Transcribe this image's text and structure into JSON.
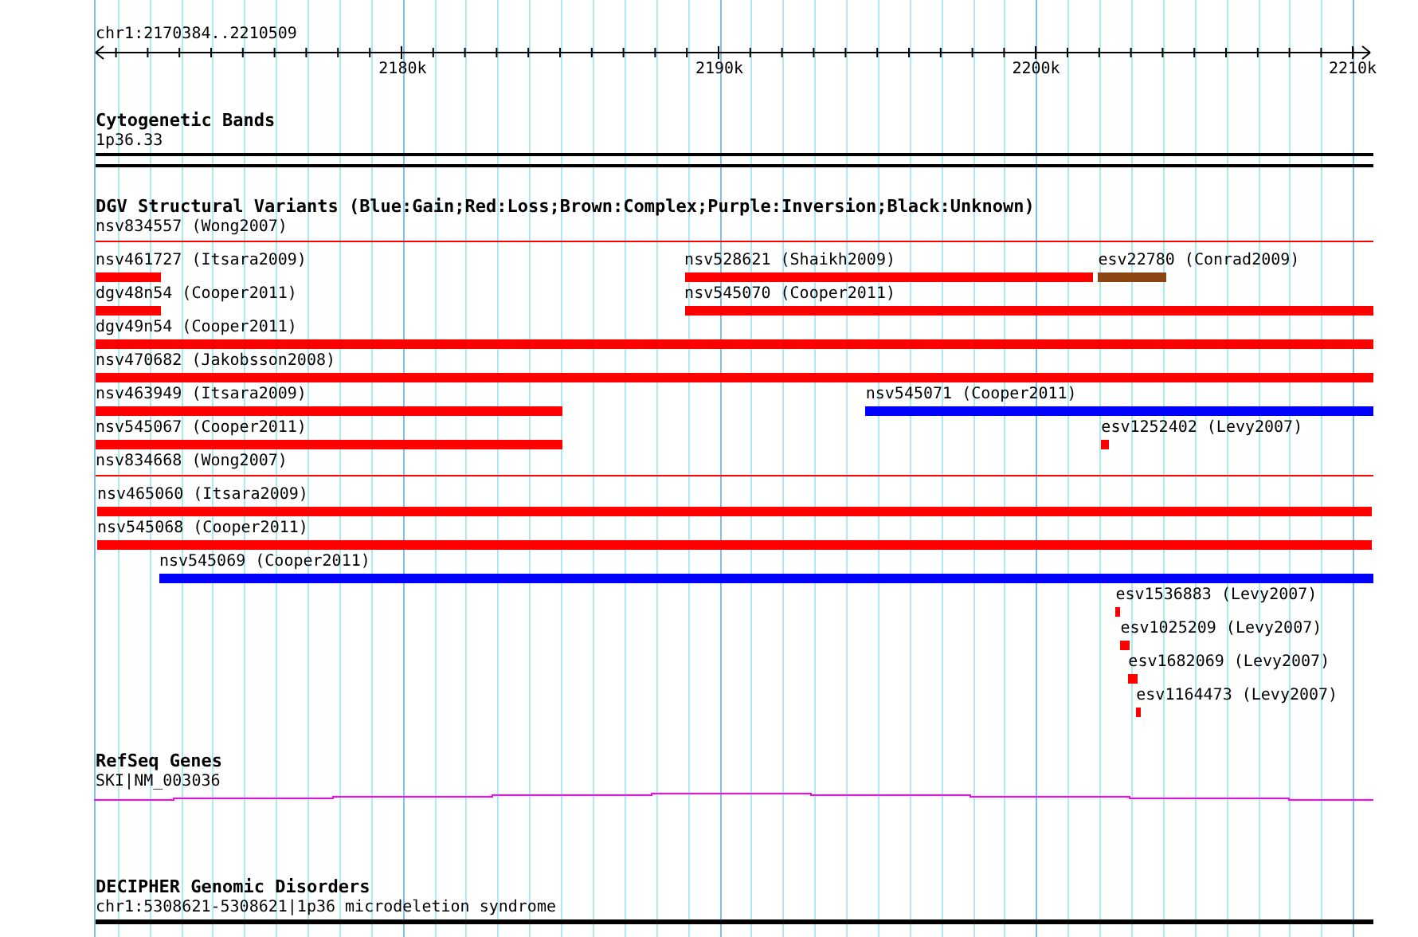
{
  "ruler": {
    "title": "chr1:2170384..2210509",
    "ticks": [
      "2180k",
      "2190k",
      "2200k",
      "2210k"
    ]
  },
  "tracks": [
    {
      "kind": "bands",
      "title": "Cytogenetic Bands",
      "feature": "1p36.33"
    },
    {
      "kind": "variants",
      "title": "DGV Structural Variants (Blue:Gain;Red:Loss;Brown:Complex;Purple:Inversion;Black:Unknown)",
      "variants": [
        {
          "label": "nsv834557 (Wong2007)",
          "color": "#ff0000",
          "kind": "line"
        },
        {
          "label": "nsv461727 (Itsara2009)",
          "color": "#ff0000",
          "kind": "bar"
        },
        {
          "label": "nsv528621 (Shaikh2009)",
          "color": "#ff0000",
          "kind": "bar"
        },
        {
          "label": "esv22780 (Conrad2009)",
          "color": "#8b4513",
          "kind": "bar"
        },
        {
          "label": "dgv48n54 (Cooper2011)",
          "color": "#ff0000",
          "kind": "bar"
        },
        {
          "label": "nsv545070 (Cooper2011)",
          "color": "#ff0000",
          "kind": "bar"
        },
        {
          "label": "dgv49n54 (Cooper2011)",
          "color": "#ff0000",
          "kind": "bar"
        },
        {
          "label": "nsv470682 (Jakobsson2008)",
          "color": "#ff0000",
          "kind": "bar"
        },
        {
          "label": "nsv463949 (Itsara2009)",
          "color": "#ff0000",
          "kind": "bar"
        },
        {
          "label": "nsv545071 (Cooper2011)",
          "color": "#0000ff",
          "kind": "bar"
        },
        {
          "label": "nsv545067 (Cooper2011)",
          "color": "#ff0000",
          "kind": "bar"
        },
        {
          "label": "esv1252402 (Levy2007)",
          "color": "#ff0000",
          "kind": "bar"
        },
        {
          "label": "nsv834668 (Wong2007)",
          "color": "#ff0000",
          "kind": "line"
        },
        {
          "label": "nsv465060 (Itsara2009)",
          "color": "#ff0000",
          "kind": "bar"
        },
        {
          "label": "nsv545068 (Cooper2011)",
          "color": "#ff0000",
          "kind": "bar"
        },
        {
          "label": "nsv545069 (Cooper2011)",
          "color": "#0000ff",
          "kind": "bar"
        },
        {
          "label": "esv1536883 (Levy2007)",
          "color": "#ff0000",
          "kind": "bar"
        },
        {
          "label": "esv1025209 (Levy2007)",
          "color": "#ff0000",
          "kind": "bar"
        },
        {
          "label": "esv1682069 (Levy2007)",
          "color": "#ff0000",
          "kind": "bar"
        },
        {
          "label": "esv1164473 (Levy2007)",
          "color": "#ff0000",
          "kind": "bar"
        }
      ]
    },
    {
      "kind": "genes",
      "title": "RefSeq Genes",
      "feature": "SKI|NM_003036"
    },
    {
      "kind": "disorders",
      "title": "DECIPHER Genomic Disorders",
      "feature": "chr1:5308621-5308621|1p36 microdeletion syndrome"
    }
  ]
}
